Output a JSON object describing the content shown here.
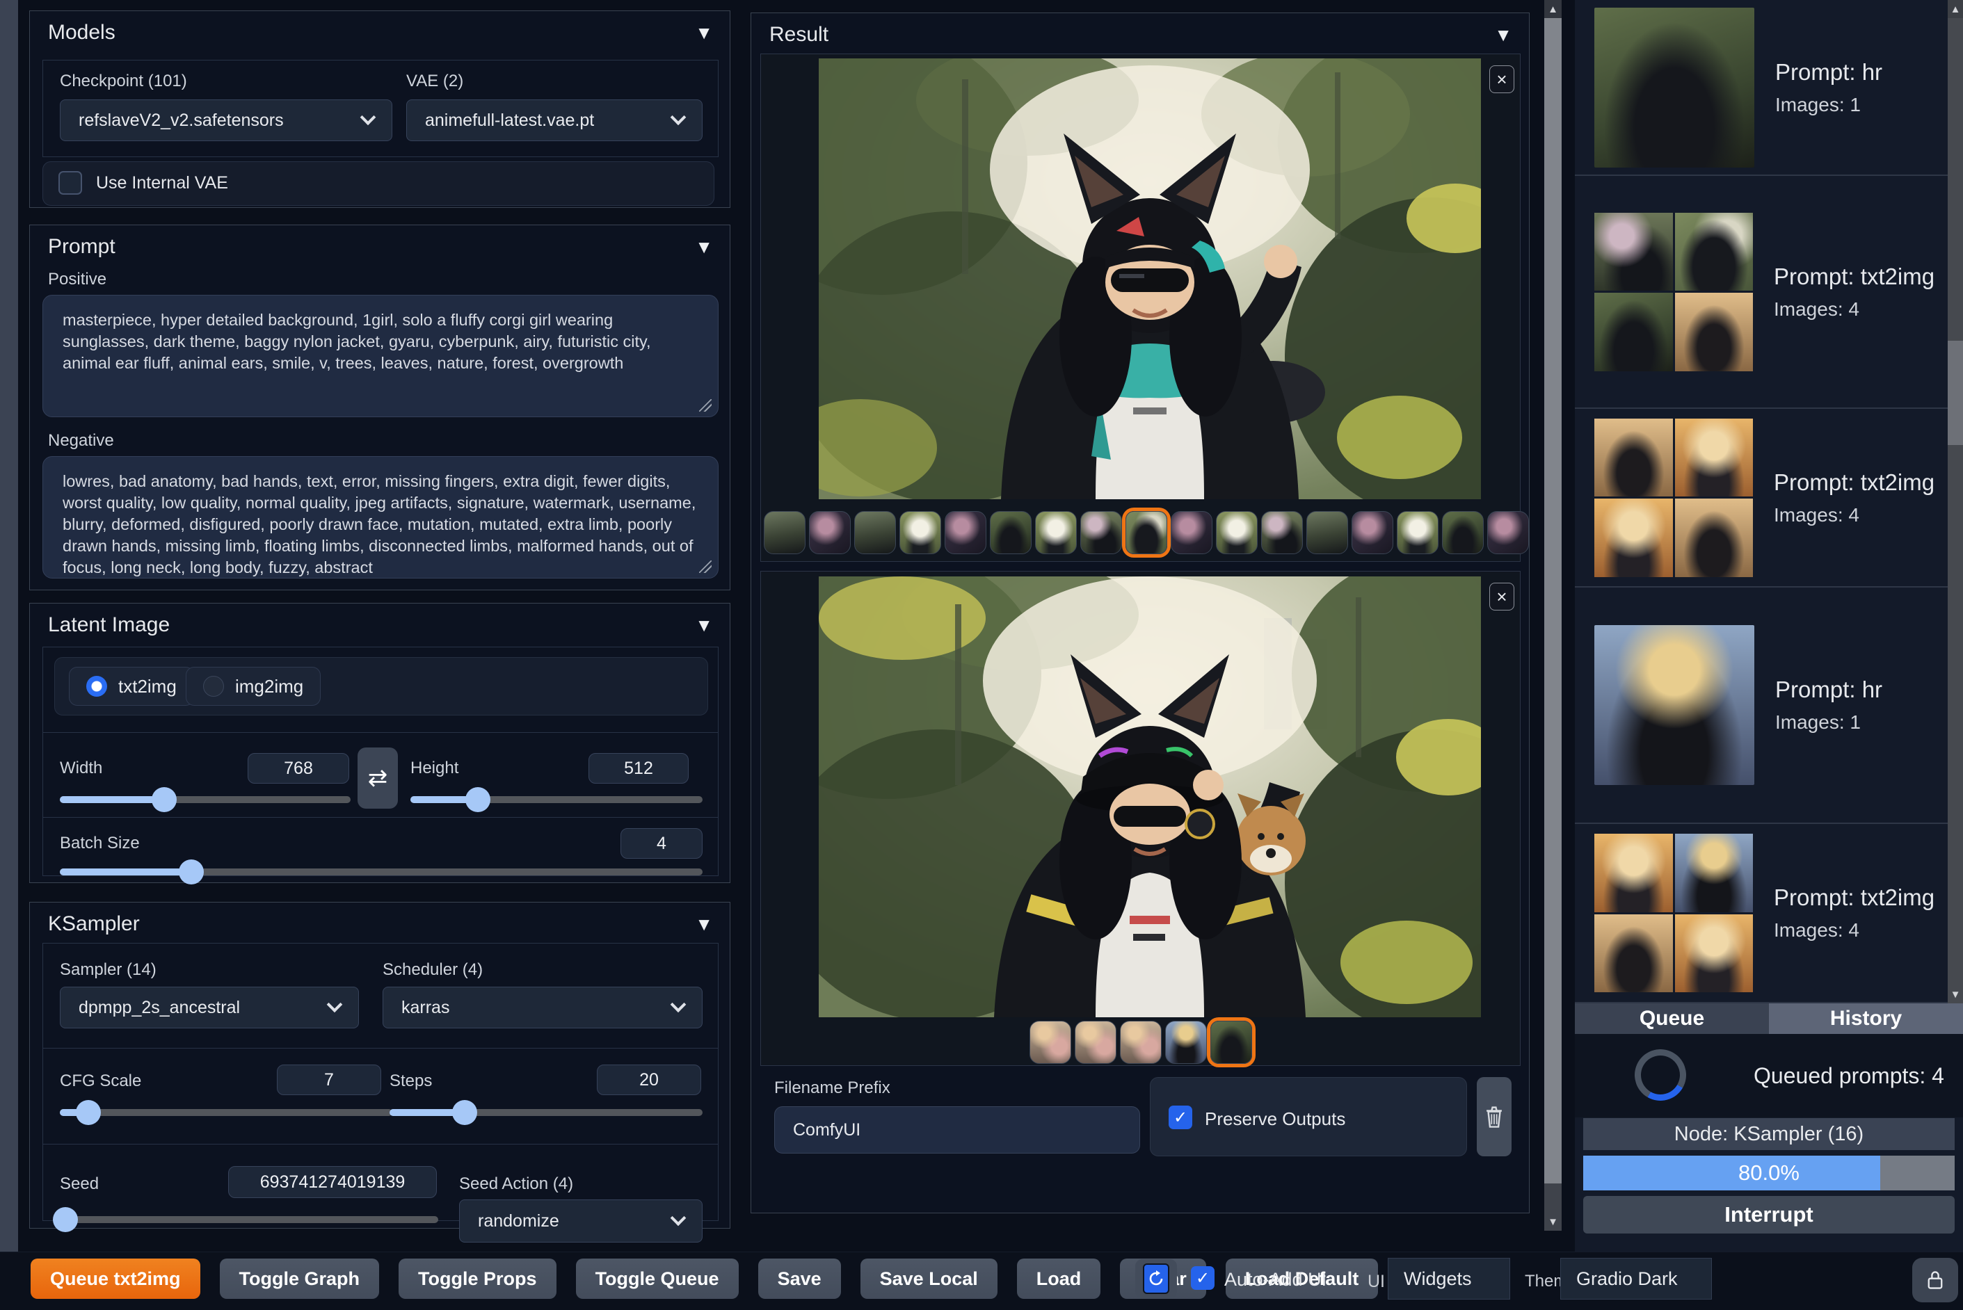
{
  "icons": {
    "collapse": "▼",
    "scroll_up": "▲",
    "scroll_down": "▼",
    "close": "×",
    "swap": "⇄",
    "check": "✓"
  },
  "colors": {
    "accent_orange": "#ef7514",
    "progress_blue": "#66a1f2",
    "checkbox_blue": "#2563eb",
    "slider_blue": "#a6c8f7"
  },
  "models": {
    "title": "Models",
    "checkpoint_label": "Checkpoint (101)",
    "checkpoint_value": "refslaveV2_v2.safetensors",
    "vae_label": "VAE (2)",
    "vae_value": "animefull-latest.vae.pt",
    "use_internal_vae_label": "Use Internal VAE",
    "use_internal_vae_checked": false
  },
  "prompt": {
    "title": "Prompt",
    "positive_label": "Positive",
    "positive_value": "masterpiece, hyper detailed background, 1girl, solo a fluffy corgi girl wearing sunglasses, dark theme, baggy nylon jacket, gyaru, cyberpunk, airy, futuristic city, animal ear fluff, animal ears, smile, v, trees, leaves, nature, forest, overgrowth",
    "negative_label": "Negative",
    "negative_value": "lowres, bad anatomy, bad hands, text, error, missing fingers, extra digit, fewer digits, worst quality, low quality, normal quality, jpeg artifacts, signature, watermark, username, blurry, deformed, disfigured, poorly drawn face, mutation, mutated, extra limb, poorly drawn hands, missing limb, floating limbs, disconnected limbs, malformed hands, out of focus, long neck, long body, fuzzy, abstract"
  },
  "latent": {
    "title": "Latent Image",
    "mode_txt2img": "txt2img",
    "mode_img2img": "img2img",
    "selected_mode": "txt2img",
    "width_label": "Width",
    "width_value": "768",
    "height_label": "Height",
    "height_value": "512",
    "batch_label": "Batch Size",
    "batch_value": "4"
  },
  "ksampler": {
    "title": "KSampler",
    "sampler_label": "Sampler (14)",
    "sampler_value": "dpmpp_2s_ancestral",
    "scheduler_label": "Scheduler (4)",
    "scheduler_value": "karras",
    "cfg_label": "CFG Scale",
    "cfg_value": "7",
    "steps_label": "Steps",
    "steps_value": "20",
    "seed_label": "Seed",
    "seed_value": "693741274019139",
    "seed_action_label": "Seed Action (4)",
    "seed_action_value": "randomize"
  },
  "result": {
    "title": "Result",
    "gallery1": {
      "count": 17,
      "selected_index": 9
    },
    "gallery2": {
      "count": 5,
      "selected_index": 5
    },
    "filename_prefix_label": "Filename Prefix",
    "filename_prefix_value": "ComfyUI",
    "preserve_outputs_label": "Preserve Outputs",
    "preserve_outputs_checked": true
  },
  "queue_panel": {
    "tabs": [
      {
        "label": "Queue",
        "active": true
      },
      {
        "label": "History",
        "active": false
      }
    ],
    "queued_prompts_text": "Queued prompts: 4",
    "node_text": "Node: KSampler (16)",
    "progress_text": "80.0%",
    "progress_pct": 80,
    "interrupt_label": "Interrupt",
    "history_entries": [
      {
        "prompt": "Prompt: hr",
        "images": "Images: 1",
        "layout": "single"
      },
      {
        "prompt": "Prompt: txt2img",
        "images": "Images: 4",
        "layout": "grid"
      },
      {
        "prompt": "Prompt: txt2img",
        "images": "Images: 4",
        "layout": "grid"
      },
      {
        "prompt": "Prompt: hr",
        "images": "Images: 1",
        "layout": "single"
      },
      {
        "prompt": "Prompt: txt2img",
        "images": "Images: 4",
        "layout": "grid"
      }
    ]
  },
  "bottom_bar": {
    "buttons": [
      {
        "label": "Queue txt2img",
        "primary": true
      },
      {
        "label": "Toggle Graph"
      },
      {
        "label": "Toggle Props"
      },
      {
        "label": "Toggle Queue"
      },
      {
        "label": "Save"
      },
      {
        "label": "Save Local"
      },
      {
        "label": "Load"
      },
      {
        "label": "Clear"
      },
      {
        "label": "Load Default"
      }
    ],
    "auto_add_label": "Auto-Add UI",
    "auto_add_checked": true,
    "ui_edit_mode_label": "UI Edit mode",
    "widgets_value": "Widgets",
    "theme_label": "Theme",
    "theme_value": "Gradio Dark"
  }
}
